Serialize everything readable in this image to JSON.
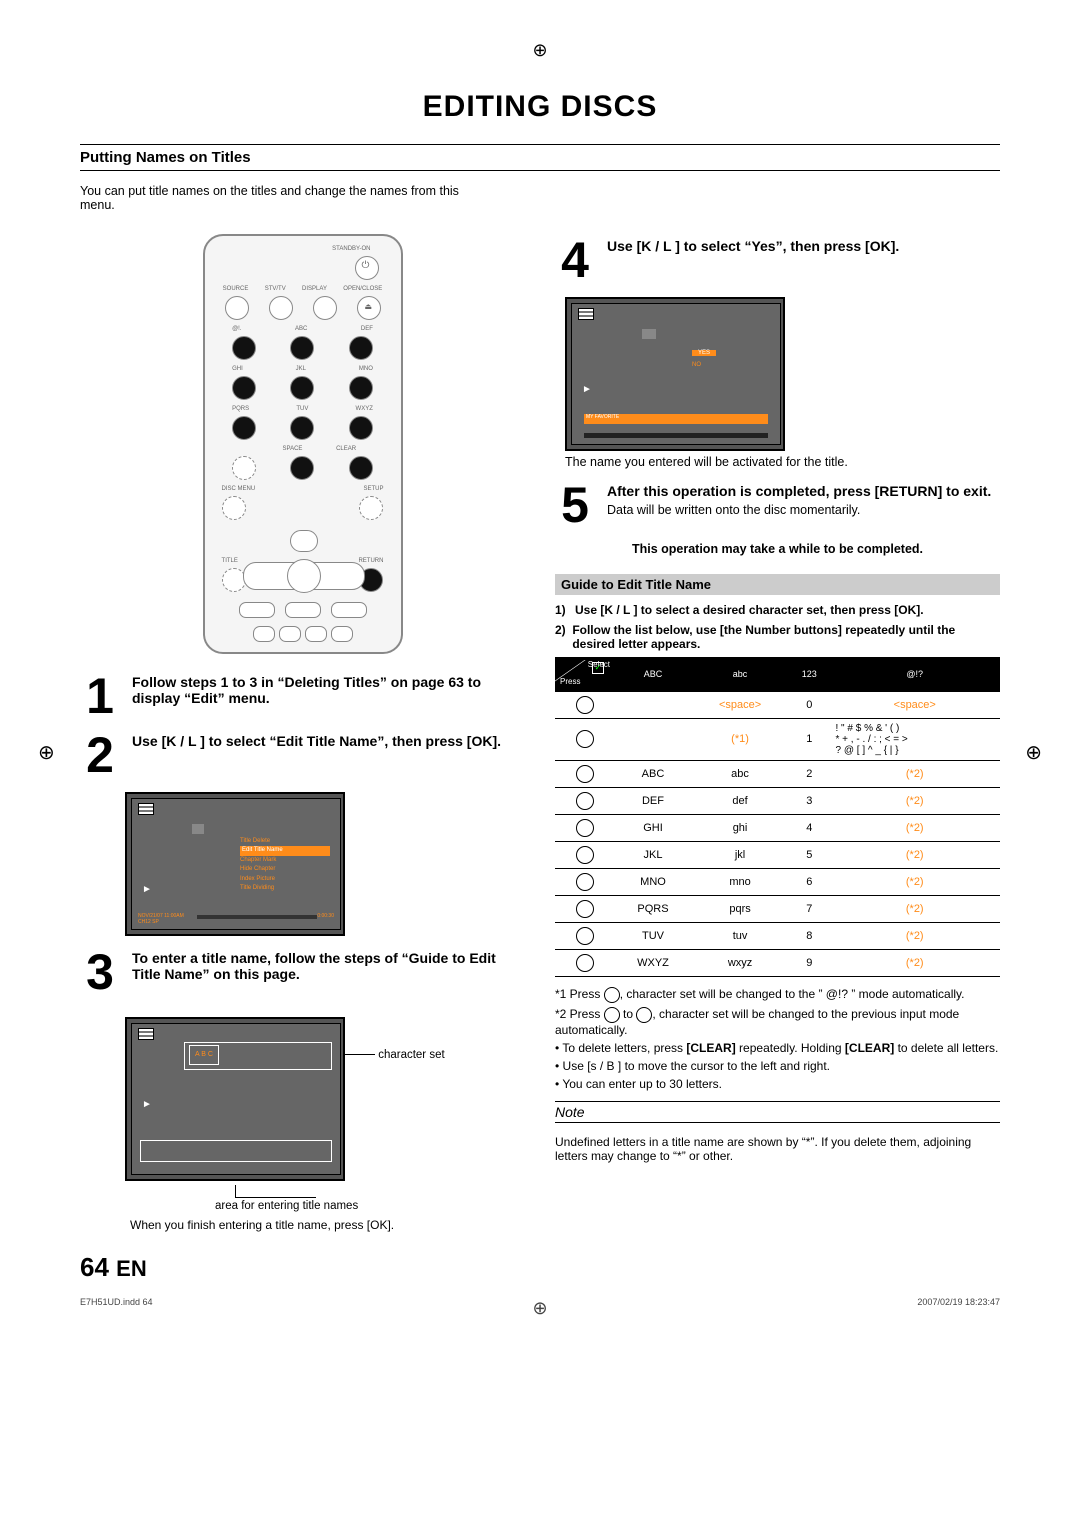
{
  "page_title": "EDITING DISCS",
  "section": "Putting Names on Titles",
  "intro": "You can put title names on the titles and change the names from this menu.",
  "remote": {
    "row1": [
      "STANDBY-ON"
    ],
    "row2": [
      "SOURCE",
      "STV/TV",
      "DISPLAY",
      "OPEN/CLOSE"
    ],
    "row3": [
      "@!.",
      "ABC",
      "DEF"
    ],
    "row4": [
      "GHI",
      "JKL",
      "MNO"
    ],
    "row5": [
      "PQRS",
      "TUV",
      "WXYZ"
    ],
    "row6": [
      "SPACE",
      "CLEAR"
    ],
    "row7": [
      "DISC MENU",
      "SETUP"
    ],
    "row8": [
      "TITLE",
      "RETURN"
    ]
  },
  "steps": {
    "1": "Follow steps 1 to 3 in “Deleting Titles” on page 63 to display “Edit” menu.",
    "2": "Use [K / L ] to select “Edit Title Name”, then press [OK].",
    "3": "To enter a title name, follow the steps of “Guide to Edit Title Name” on this page.",
    "4": "Use [K / L ] to select “Yes”, then press [OK].",
    "5": "After this operation is completed, press [RETURN] to exit.",
    "5sub": "Data will be written onto the disc momentarily."
  },
  "osd2_menu": {
    "item1": "Title Delete",
    "item2": "Edit Title Name",
    "item3": "Chapter Mark",
    "item4": "Hide Chapter",
    "item5": "Index Picture",
    "item6": "Title Dividing"
  },
  "osd2_meta": {
    "left": "NOV/21/07 11:00AM CH12 SP",
    "right": "0:00:30"
  },
  "osd3_chars": "A B C",
  "osd3_caption1": "character set",
  "osd3_caption2": "area for entering title names",
  "osd3_after": "When you finish entering a title name, press [OK].",
  "osd4_yes": "YES",
  "osd4_no": "NO",
  "osd4_fave": "MY FAVORITE",
  "osd4_after": "The name you entered will be activated for the title.",
  "warn": "This operation may take a while to be completed.",
  "guide": {
    "header": "Guide to Edit Title Name",
    "step1": "Use [K / L ] to select a desired character set, then press [OK].",
    "step2": "Follow the list below, use [the Number buttons] repeatedly until the desired letter appears."
  },
  "table": {
    "head": [
      "",
      "ABC",
      "abc",
      "123",
      "@!?"
    ],
    "select": "Select",
    "press": "Press",
    "rows": [
      {
        "col2": "",
        "col3": "<space>",
        "col4": "0",
        "col5": "<space>"
      },
      {
        "col2": "",
        "col3": "(*1)",
        "col4": "1",
        "col5": "! \" # $ % & ' ( )\n* + , - . / : ; < = >\n? @ [ ] ^ _ { | }"
      },
      {
        "col2": "ABC",
        "col3": "abc",
        "col4": "2",
        "col5": "(*2)"
      },
      {
        "col2": "DEF",
        "col3": "def",
        "col4": "3",
        "col5": "(*2)"
      },
      {
        "col2": "GHI",
        "col3": "ghi",
        "col4": "4",
        "col5": "(*2)"
      },
      {
        "col2": "JKL",
        "col3": "jkl",
        "col4": "5",
        "col5": "(*2)"
      },
      {
        "col2": "MNO",
        "col3": "mno",
        "col4": "6",
        "col5": "(*2)"
      },
      {
        "col2": "PQRS",
        "col3": "pqrs",
        "col4": "7",
        "col5": "(*2)"
      },
      {
        "col2": "TUV",
        "col3": "tuv",
        "col4": "8",
        "col5": "(*2)"
      },
      {
        "col2": "WXYZ",
        "col3": "wxyz",
        "col4": "9",
        "col5": "(*2)"
      }
    ]
  },
  "footnotes": {
    "f1a": "*1 Press ",
    "f1b": ", character set will be changed to the ” @!? ” mode automatically.",
    "f2a": "*2 Press ",
    "f2b": " to ",
    "f2c": ", character set will be changed to the previous input mode automatically.",
    "b1a": "To delete letters, press ",
    "b1b": "[CLEAR]",
    "b1c": " repeatedly. Holding ",
    "b1d": "[CLEAR]",
    "b1e": " to delete all letters.",
    "b2": "Use [s  / B ] to move the cursor to the left and right.",
    "b3": "You can enter up to 30 letters."
  },
  "note": {
    "header": "Note",
    "body": "Undefined letters in a title name are shown by “*”. If you delete them, adjoining letters may change to “*” or other."
  },
  "page_num": "64",
  "page_lang": "EN",
  "print_left": "E7H51UD.indd   64",
  "print_right": "2007/02/19   18:23:47"
}
